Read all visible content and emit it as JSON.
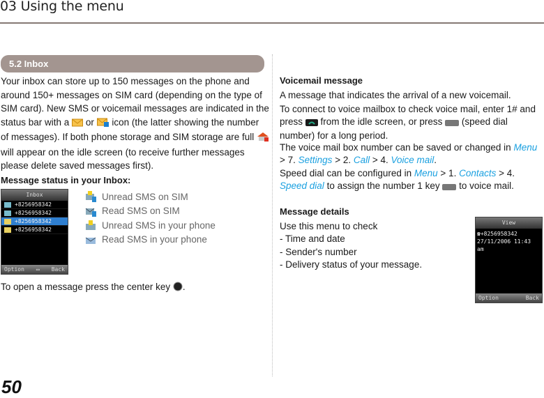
{
  "chapter_title": "03 Using the menu",
  "page_number": "50",
  "section": {
    "label": "5.2  Inbox"
  },
  "left": {
    "intro": {
      "t1": "Your inbox can store up to 150 messages on the phone and around 150+ messages on SIM card (depending on the type of SIM card). New SMS or voicemail messages are indicated in the status bar with a ",
      "t2": " or ",
      "t3": " icon (the latter showing the number of messages). If both phone storage and SIM storage are full ",
      "t4": " will appear on the idle screen (to receive further messages please delete saved messages first)."
    },
    "status_heading": "Message status in your Inbox:",
    "status_items": [
      {
        "label": "Unread SMS on SIM",
        "icon": "unread-sim-sms-icon"
      },
      {
        "label": "Read SMS on SIM",
        "icon": "read-sim-sms-icon"
      },
      {
        "label": "Unread SMS in your phone",
        "icon": "unread-phone-sms-icon"
      },
      {
        "label": "Read SMS in your phone",
        "icon": "read-phone-sms-icon"
      }
    ],
    "inbox_screen": {
      "title": "Inbox",
      "rows": [
        "+8256958342",
        "+8256958342",
        "+8256958342",
        "+8256958342"
      ],
      "selected_index": 2,
      "softkey_left": "Option",
      "softkey_right": "Back"
    },
    "open_text": {
      "t1": "To open a message press the center key ",
      "t2": "."
    }
  },
  "right": {
    "voicemail_heading": "Voicemail message",
    "vm_p1": "A message that indicates the arrival of a new voicemail.",
    "vm_p2": {
      "t1": "To connect to voice mailbox to check voice mail, enter 1# and press ",
      "t2": " from the idle screen, or press ",
      "t3": " (speed dial number) for a long period."
    },
    "vm_p3": {
      "t1": "The voice mail box number can be saved or changed in ",
      "menu": "Menu",
      "t2": " > 7. ",
      "settings": "Settings",
      "t3": " > 2. ",
      "call": "Call",
      "t4": " > 4. ",
      "voicemail": "Voice mail",
      "t5": "."
    },
    "vm_p4": {
      "t1": "Speed dial can be configured in ",
      "menu": "Menu",
      "t2": " > 1. ",
      "contacts": "Contacts",
      "t3": " > 4. ",
      "speed_dial": "Speed dial",
      "t4": " to assign the number 1 key ",
      "t5": " to voice mail."
    },
    "details_heading": "Message details",
    "details_intro": "Use this menu to check",
    "details_items": [
      "- Time and date",
      "- Sender's number",
      "- Delivery status of your message."
    ],
    "view_screen": {
      "title": "View",
      "number": "+8256958342",
      "datetime": "27/11/2006 11:43 am",
      "softkey_left": "Option",
      "softkey_right": "Back"
    }
  },
  "colors": {
    "accent_link": "#1aa0e0",
    "section_bar": "#a39590",
    "rule": "#857873"
  }
}
